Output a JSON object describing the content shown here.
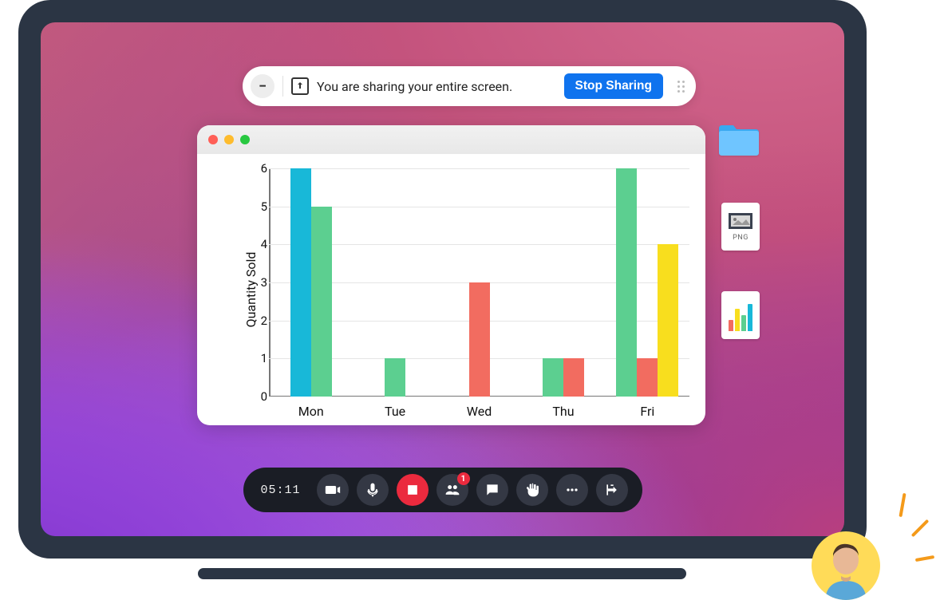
{
  "share_bar": {
    "message": "You are sharing your entire screen.",
    "stop_label": "Stop Sharing"
  },
  "desktop": {
    "png_label": "PNG"
  },
  "control_bar": {
    "timer": "05:11",
    "participants_badge": "1"
  },
  "chart_data": {
    "type": "bar",
    "ylabel": "Quantity Sold",
    "categories": [
      "Mon",
      "Tue",
      "Wed",
      "Thu",
      "Fri"
    ],
    "y_ticks": [
      0,
      1,
      2,
      3,
      4,
      5,
      6
    ],
    "ylim": [
      0,
      6
    ],
    "series": [
      {
        "name": "A",
        "color": "#18b8d8",
        "values": [
          6,
          null,
          null,
          null,
          null
        ]
      },
      {
        "name": "B",
        "color": "#5ccf90",
        "values": [
          5,
          1,
          null,
          1,
          6
        ]
      },
      {
        "name": "C",
        "color": "#f26c60",
        "values": [
          null,
          null,
          3,
          1,
          1
        ]
      },
      {
        "name": "D",
        "color": "#f8de1e",
        "values": [
          null,
          null,
          null,
          null,
          4
        ]
      }
    ]
  },
  "colors": {
    "accent_blue": "#0f73ee",
    "danger_red": "#eb2a3e"
  }
}
